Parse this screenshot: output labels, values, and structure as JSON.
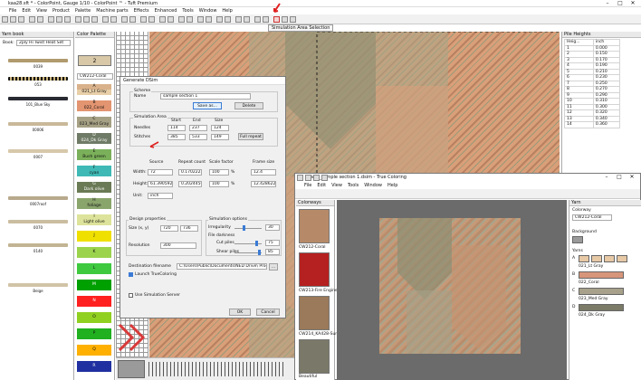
{
  "app": {
    "title": "kaa28.sft * - ColorPoint, Gauge 1/10 - ColorPoint ™ - Tuft Premium",
    "menu": [
      "File",
      "Edit",
      "View",
      "Product",
      "Palette",
      "Machine parts",
      "Effects",
      "Enhanced",
      "Tools",
      "Window",
      "Help"
    ],
    "tooltip": "Simulation Area Selection"
  },
  "yarn_book": {
    "title": "Yarn book",
    "book_label": "Book:",
    "book_value": "2ply Hi Twist Heat Set",
    "items": [
      {
        "label": "0039",
        "color": "#b09a6e"
      },
      {
        "label": "053",
        "color": "#3b3a3a"
      },
      {
        "label": "101_Blue Sky",
        "color": "#2a2a33"
      },
      {
        "label": "00006",
        "color": "#c9b99a"
      },
      {
        "label": "0007",
        "color": "#d6c8aa"
      },
      {
        "label": "0007roof",
        "color": "#b8a98c"
      },
      {
        "label": "0070",
        "color": "#cbbda0"
      },
      {
        "label": "0140",
        "color": "#c2b493"
      },
      {
        "label": "Beige",
        "color": "#d1c3a6"
      }
    ]
  },
  "color_palette": {
    "title": "Color Palette",
    "current_num": "2",
    "dropdown": "CW212-Coral",
    "swatches": [
      {
        "code": "A",
        "name": "",
        "color": "#d9b28b"
      },
      {
        "code": "",
        "name": "021_Lt Gray",
        "color": "#e8cfa8"
      },
      {
        "code": "B",
        "name": "",
        "color": "#e39470"
      },
      {
        "code": "",
        "name": "022_Coral",
        "color": "#e39470"
      },
      {
        "code": "C",
        "name": "",
        "color": "#a6a184"
      },
      {
        "code": "",
        "name": "023_Med Gray",
        "color": "#a6a184"
      },
      {
        "code": "D",
        "name": "",
        "color": "#6f7b66"
      },
      {
        "code": "",
        "name": "024_Dk Gray",
        "color": "#6f7b66"
      },
      {
        "code": "E",
        "name": "",
        "color": "#7bb05a"
      },
      {
        "code": "",
        "name": "Bush green",
        "color": "#7bb05a"
      },
      {
        "code": "F",
        "name": "",
        "color": "#3fb9b5"
      },
      {
        "code": "",
        "name": "cyan",
        "color": "#3fb9b5"
      },
      {
        "code": "G",
        "name": "",
        "color": "#6a7a55"
      },
      {
        "code": "",
        "name": "Dark olive",
        "color": "#6a7a55"
      },
      {
        "code": "H",
        "name": "",
        "color": "#8aa56c"
      },
      {
        "code": "",
        "name": "foliage",
        "color": "#8aa56c"
      },
      {
        "code": "I",
        "name": "",
        "color": "#dde39a"
      },
      {
        "code": "",
        "name": "Light olive",
        "color": "#dde39a"
      },
      {
        "code": "J",
        "name": "",
        "color": "#f0e000"
      },
      {
        "code": "K",
        "name": "",
        "color": "#9bd34d"
      },
      {
        "code": "L",
        "name": "",
        "color": "#3ec93e"
      },
      {
        "code": "M",
        "name": "",
        "color": "#00a000"
      },
      {
        "code": "N",
        "name": "",
        "color": "#ff2020"
      },
      {
        "code": "O",
        "name": "",
        "color": "#90d020"
      },
      {
        "code": "P",
        "name": "",
        "color": "#20b020"
      },
      {
        "code": "Q",
        "name": "",
        "color": "#ffb000"
      },
      {
        "code": "R",
        "name": "",
        "color": "#2030a0"
      }
    ]
  },
  "pile_heights": {
    "title": "Pile Heights",
    "col_height": "Heig...",
    "col_inch": "inch",
    "rows": [
      [
        "1",
        "0.000"
      ],
      [
        "2",
        "0.150"
      ],
      [
        "3",
        "0.170"
      ],
      [
        "4",
        "0.190"
      ],
      [
        "5",
        "0.210"
      ],
      [
        "6",
        "0.230"
      ],
      [
        "7",
        "0.250"
      ],
      [
        "8",
        "0.270"
      ],
      [
        "9",
        "0.290"
      ],
      [
        "10",
        "0.310"
      ],
      [
        "11",
        "0.300"
      ],
      [
        "12",
        "0.320"
      ],
      [
        "13",
        "0.340"
      ],
      [
        "14",
        "0.360"
      ]
    ]
  },
  "dialog": {
    "title": "Generate DSim",
    "scheme_group": "Scheme",
    "name_label": "Name",
    "name_value": "sample section 1",
    "save_as": "Save as...",
    "delete": "Delete",
    "sim_area_group": "Simulation Area",
    "col_start": "Start",
    "col_end": "End",
    "col_size": "Size",
    "needles_label": "Needles",
    "needles": [
      "114",
      "237",
      "124"
    ],
    "stitches_label": "Stitches",
    "stitches": [
      "385",
      "533",
      "149"
    ],
    "full_repeat": "Full repeat",
    "source_label": "Source",
    "repeat_count_label": "Repeat count",
    "scale_factor_label": "Scale factor",
    "frame_size_label": "Frame size",
    "width_label": "Width:",
    "width_source": "72",
    "width_repeat": "0.17022222",
    "width_scale": "100",
    "width_scale_unit": "%",
    "width_frame": "12.4",
    "height_label": "Height:",
    "height_source": "61.39059211",
    "height_repeat": "0.20244566",
    "height_scale": "100",
    "height_scale_unit": "%",
    "height_frame": "12.42862204",
    "unit_label": "Unit:",
    "unit_value": "inch",
    "design_props": "Design properties",
    "size_label": "Size (x, y)",
    "size_x": "720",
    "size_y": "736",
    "resolution_label": "Resolution",
    "resolution": "300",
    "sim_options": "Simulation options",
    "irregularity_label": "Irregularity",
    "irregularity": "30",
    "irregularity_level": 0.3,
    "file_darkness": "File darkness",
    "cut_piles_label": "Cut piles",
    "cut_piles": "75",
    "cut_piles_level": 0.75,
    "shear_piles_label": "Shear piles",
    "shear_piles": "85",
    "shear_piles_level": 0.85,
    "dest_label": "Destination filename",
    "dest_value": "C:\\Users\\Public\\Documents\\NED Drive\\ Production\\22 Sfc\\",
    "browse": "...",
    "launch_tc": "Launch TrueColoring",
    "use_sim_server": "Use Simulation Server",
    "ok": "OK",
    "cancel": "Cancel"
  },
  "truecoloring": {
    "title": "kaa28_sample section 1.dsim - True Coloring",
    "menu": [
      "File",
      "Edit",
      "View",
      "Tools",
      "Window",
      "Help"
    ],
    "colorways_title": "Colorways",
    "colorways": [
      {
        "label": "CW212-Coral"
      },
      {
        "label": "CW213-Fire Engine"
      },
      {
        "label": "CW214_KA428-Sunrise"
      },
      {
        "label": "Beautiful"
      }
    ],
    "yarn_title": "Yarn",
    "colorway_label": "Colorway",
    "colorway_value": "CW212-Coral",
    "background_label": "Background",
    "yarns_label": "Yarns",
    "yarns": [
      {
        "code": "A",
        "name": "021_Lt Gray",
        "color": "#e7c9a6"
      },
      {
        "code": "B",
        "name": "022_Coral",
        "color": "#d7957b"
      },
      {
        "code": "C",
        "name": "023_Med Gray",
        "color": "#a7a18b"
      },
      {
        "code": "D",
        "name": "024_Dk Gray",
        "color": "#7b7b68"
      }
    ]
  }
}
